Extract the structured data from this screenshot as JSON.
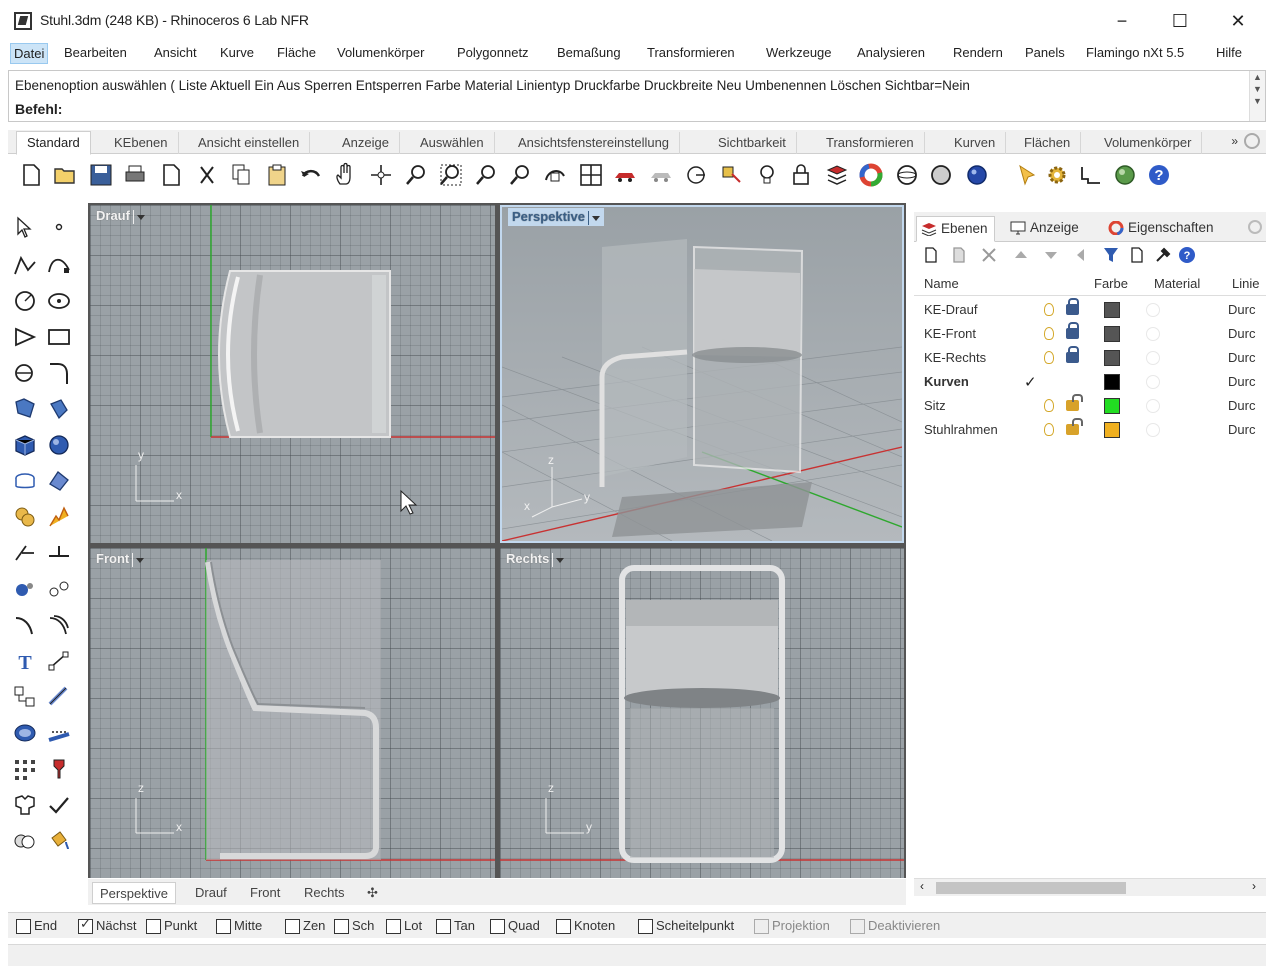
{
  "window": {
    "title": "Stuhl.3dm (248 KB) - Rhinoceros 6 Lab NFR",
    "minimize": "−",
    "maximize": "☐",
    "close": "✕"
  },
  "menu": [
    "Datei",
    "Bearbeiten",
    "Ansicht",
    "Kurve",
    "Fläche",
    "Volumenkörper",
    "Polygonnetz",
    "Bemaßung",
    "Transformieren",
    "Werkzeuge",
    "Analysieren",
    "Rendern",
    "Panels",
    "Flamingo nXt 5.5",
    "Hilfe"
  ],
  "command": {
    "history": "Ebenenoption auswählen ( Liste  Aktuell  Ein  Aus  Sperren  Entsperren  Farbe  Material  Linientyp  Druckfarbe  Druckbreite  Neu  Umbenennen  Löschen  Sichtbar=Nein",
    "prompt": "Befehl:"
  },
  "toolbar_tabs": [
    "Standard",
    "KEbenen",
    "Ansicht einstellen",
    "Anzeige",
    "Auswählen",
    "Ansichtsfenstereinstellung",
    "Sichtbarkeit",
    "Transformieren",
    "Kurven",
    "Flächen",
    "Volumenkörper"
  ],
  "toolbar_more": "»",
  "viewports": {
    "top": "Drauf",
    "perspective": "Perspektive",
    "front": "Front",
    "right": "Rechts"
  },
  "axes": {
    "top": {
      "v": "y",
      "h": "x"
    },
    "front": {
      "v": "z",
      "h": "x"
    },
    "right": {
      "v": "z",
      "h": "y"
    },
    "persp": {
      "z": "z",
      "x": "x",
      "y": "y"
    }
  },
  "viewport_tabs": [
    "Perspektive",
    "Drauf",
    "Front",
    "Rechts",
    "✣"
  ],
  "panel": {
    "tabs": [
      "Ebenen",
      "Anzeige",
      "Eigenschaften"
    ],
    "columns": {
      "name": "Name",
      "color": "Farbe",
      "material": "Material",
      "linetype": "Linie"
    },
    "layers": [
      {
        "name": "KE-Drauf",
        "color": "#555555",
        "locked": true,
        "current": false,
        "linetype": "Durc"
      },
      {
        "name": "KE-Front",
        "color": "#555555",
        "locked": true,
        "current": false,
        "linetype": "Durc"
      },
      {
        "name": "KE-Rechts",
        "color": "#555555",
        "locked": true,
        "current": false,
        "linetype": "Durc"
      },
      {
        "name": "Kurven",
        "color": "#000000",
        "locked": false,
        "current": true,
        "linetype": "Durc"
      },
      {
        "name": "Sitz",
        "color": "#22dd22",
        "locked": false,
        "current": false,
        "linetype": "Durc"
      },
      {
        "name": "Stuhlrahmen",
        "color": "#f0b020",
        "locked": false,
        "current": false,
        "linetype": "Durc"
      }
    ]
  },
  "osnaps": [
    {
      "label": "End",
      "checked": false,
      "enabled": true
    },
    {
      "label": "Nächst",
      "checked": true,
      "enabled": true
    },
    {
      "label": "Punkt",
      "checked": false,
      "enabled": true
    },
    {
      "label": "Mitte",
      "checked": false,
      "enabled": true
    },
    {
      "label": "Zen",
      "checked": false,
      "enabled": true
    },
    {
      "label": "Sch",
      "checked": false,
      "enabled": true
    },
    {
      "label": "Lot",
      "checked": false,
      "enabled": true
    },
    {
      "label": "Tan",
      "checked": false,
      "enabled": true
    },
    {
      "label": "Quad",
      "checked": false,
      "enabled": true
    },
    {
      "label": "Knoten",
      "checked": false,
      "enabled": true
    },
    {
      "label": "Scheitelpunkt",
      "checked": false,
      "enabled": true
    },
    {
      "label": "Projektion",
      "checked": false,
      "enabled": false
    },
    {
      "label": "Deaktivieren",
      "checked": false,
      "enabled": false
    }
  ],
  "colors": {
    "axis_red": "#c83232",
    "axis_green": "#2ea82e",
    "viewport_bg": "#9aa1a6",
    "active_viewport_title": "#c2d8ee"
  }
}
